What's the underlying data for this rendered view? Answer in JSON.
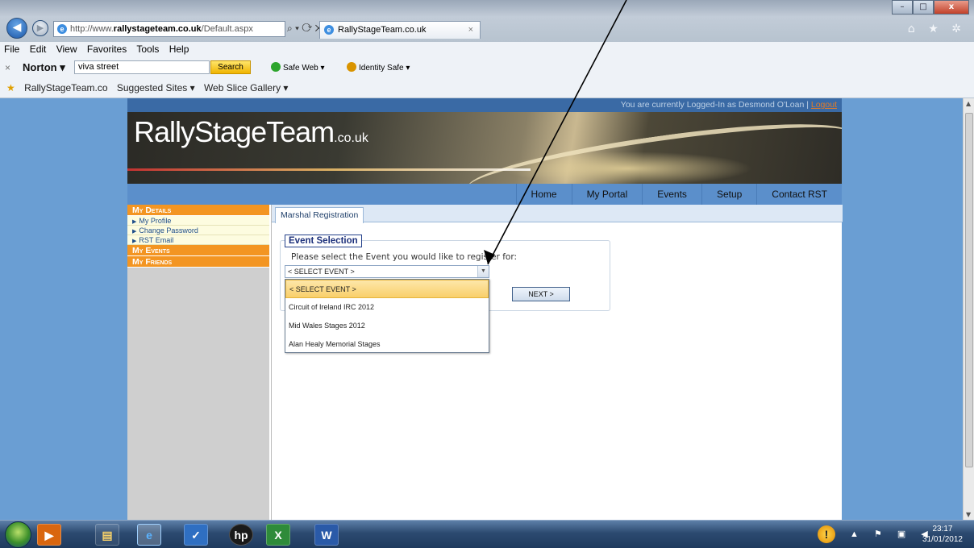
{
  "browser": {
    "address_prefix": "http://www.",
    "address_domain": "rallystageteam.co.uk",
    "address_suffix": "/Default.aspx",
    "address_controls": "⌕ ▾ ⟳ ✕",
    "tab_title": "RallyStageTeam.co.uk",
    "tab_close": "×",
    "window_buttons": [
      "–",
      "□",
      "x"
    ],
    "toolbar_icons": "⌂ ★ ✲",
    "menu": [
      "File",
      "Edit",
      "View",
      "Favorites",
      "Tools",
      "Help"
    ],
    "norton": {
      "close": "×",
      "brand": "Norton ▾",
      "search_value": "viva street",
      "search_button": "Search",
      "safe_web": "Safe Web ▾",
      "identity_safe": "Identity Safe ▾"
    },
    "favorites": [
      "RallyStageTeam.co",
      "Suggested Sites ▾",
      "Web Slice Gallery ▾"
    ]
  },
  "site": {
    "login_text": "You are currently Logged-In as  Desmond O'Loan  | ",
    "logout_label": "Logout",
    "logo": "RallyStageTeam",
    "logo_suffix": ".co.uk",
    "nav": [
      "Home",
      "My Portal",
      "Events",
      "Setup",
      "Contact RST"
    ],
    "sidebar": {
      "my_details": "My Details",
      "items": [
        "My Profile",
        "Change Password",
        "RST Email"
      ],
      "my_events": "My Events",
      "my_friends": "My Friends"
    },
    "tab_label": "Marshal Registration",
    "section_title": "Event Selection",
    "prompt": "Please select the Event you would like to register for:",
    "select_value": "< SELECT EVENT >",
    "options": [
      "< SELECT EVENT >",
      "Circuit of Ireland IRC 2012",
      "Mid Wales Stages 2012",
      "Alan Healy Memorial Stages"
    ],
    "next_button": "NEXT >"
  },
  "taskbar": {
    "time": "23:17",
    "date": "31/01/2012"
  }
}
